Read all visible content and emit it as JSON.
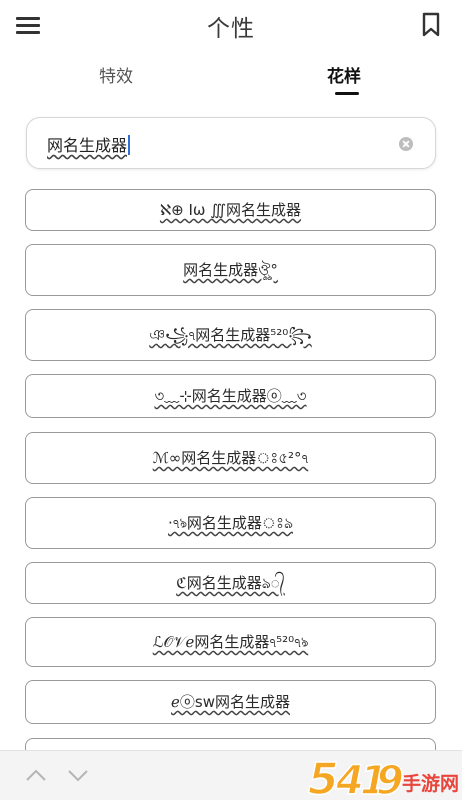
{
  "header": {
    "title": "个性",
    "menu_icon": "hamburger-menu-icon",
    "bookmark_icon": "bookmark-icon"
  },
  "tabs": [
    {
      "label": "特效",
      "active": false
    },
    {
      "label": "花样",
      "active": true
    }
  ],
  "search": {
    "value": "网名生成器",
    "clear_icon": "clear-circle-icon"
  },
  "results": [
    "ℵ⊕ Ⅰω ∭网名生成器",
    "网名生成器ঔৣ°",
    "ঞ꧁ঀ网名生成器⁵²⁰꧂",
    "৩﹏⊹网名生成器ⓞ﹏৩",
    "ℳ∞网名生成器ঃ৫²°ঀ",
    "·ঀঌ网名生成器ঃঌ",
    "ℭ网名生成器ঌ᭄",
    "ℒ𝒪𝒱ℯ网名生成器ঀ⁵²⁰ঀঌ",
    "ℯⓞsw网名生成器"
  ],
  "bottom_nav": {
    "up_icon": "chevron-up-icon",
    "down_icon": "chevron-down-icon"
  },
  "watermark": {
    "text": "5419手游网",
    "colors": {
      "primary": "#f5a623",
      "secondary": "#e8453c"
    }
  }
}
